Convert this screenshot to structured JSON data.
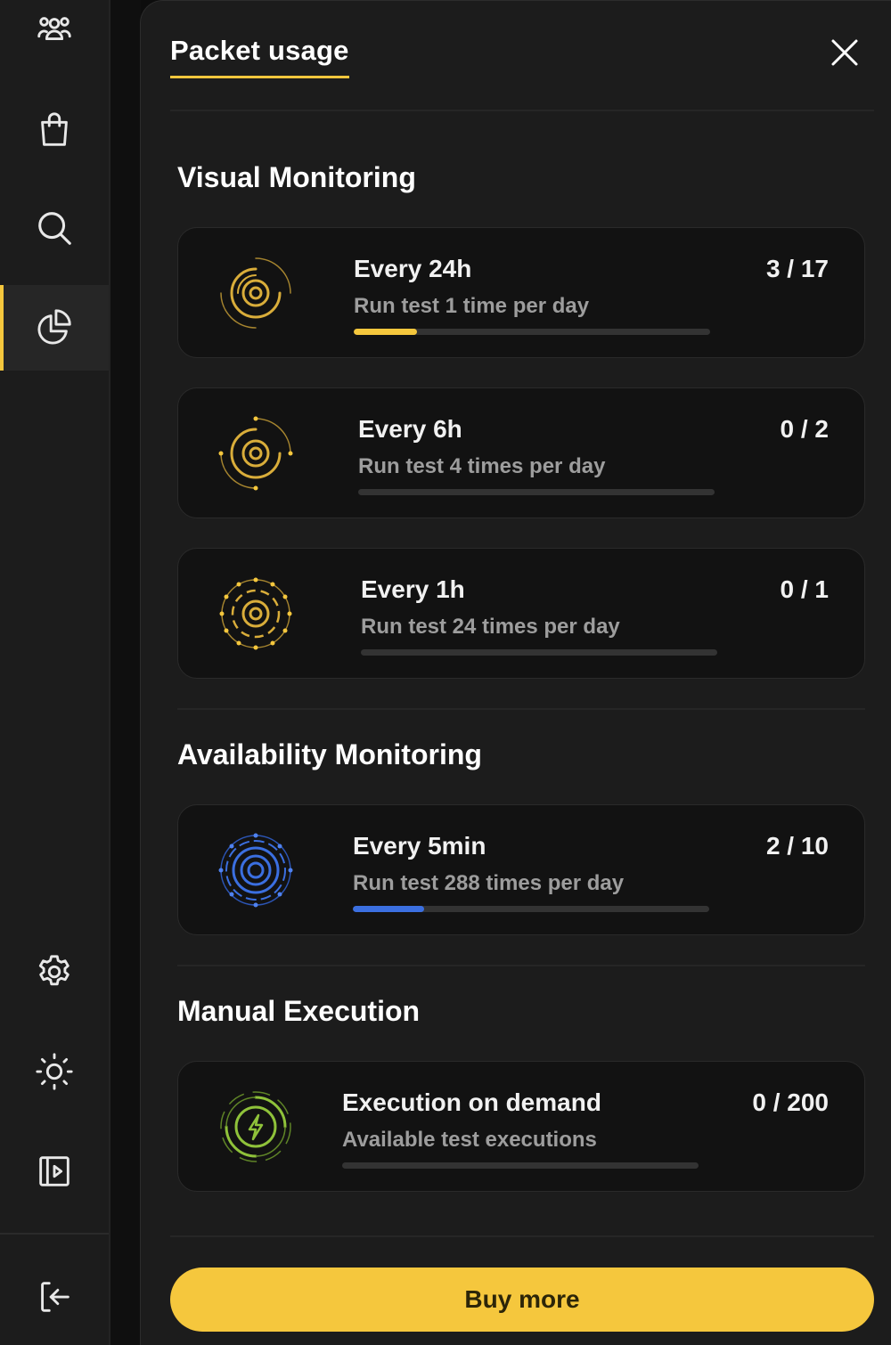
{
  "sidebar": {
    "items": [
      {
        "icon": "team-icon"
      },
      {
        "icon": "shopping-bag-icon"
      },
      {
        "icon": "search-icon"
      },
      {
        "icon": "pie-chart-icon",
        "active": true
      },
      {
        "icon": "gear-icon"
      },
      {
        "icon": "sun-icon"
      },
      {
        "icon": "sidebar-toggle-icon"
      },
      {
        "icon": "logout-icon"
      }
    ]
  },
  "panel": {
    "title": "Packet usage",
    "close_icon": "close-icon"
  },
  "sections": {
    "visual": {
      "title": "Visual Monitoring",
      "items": [
        {
          "title": "Every 24h",
          "subtitle": "Run test 1 time per day",
          "count": "3 / 17",
          "used": 3,
          "total": 17,
          "color": "#f5c73d",
          "icon": "target-24h-icon"
        },
        {
          "title": "Every 6h",
          "subtitle": "Run test 4 times per day",
          "count": "0 / 2",
          "used": 0,
          "total": 2,
          "color": "#f5c73d",
          "icon": "target-6h-icon"
        },
        {
          "title": "Every 1h",
          "subtitle": "Run test 24 times per day",
          "count": "0 / 1",
          "used": 0,
          "total": 1,
          "color": "#f5c73d",
          "icon": "target-1h-icon"
        }
      ]
    },
    "availability": {
      "title": "Availability Monitoring",
      "items": [
        {
          "title": "Every 5min",
          "subtitle": "Run test 288 times per day",
          "count": "2 / 10",
          "used": 2,
          "total": 10,
          "color": "#3b6fe0",
          "icon": "target-5min-icon"
        }
      ]
    },
    "manual": {
      "title": "Manual Execution",
      "items": [
        {
          "title": "Execution on demand",
          "subtitle": "Available test executions",
          "count": "0 / 200",
          "used": 0,
          "total": 200,
          "color": "#8fc23a",
          "icon": "lightning-icon"
        }
      ]
    }
  },
  "buy_button": {
    "label": "Buy more"
  },
  "colors": {
    "accent": "#f5c73d",
    "availability": "#3b6fe0",
    "manual": "#8fc23a"
  }
}
